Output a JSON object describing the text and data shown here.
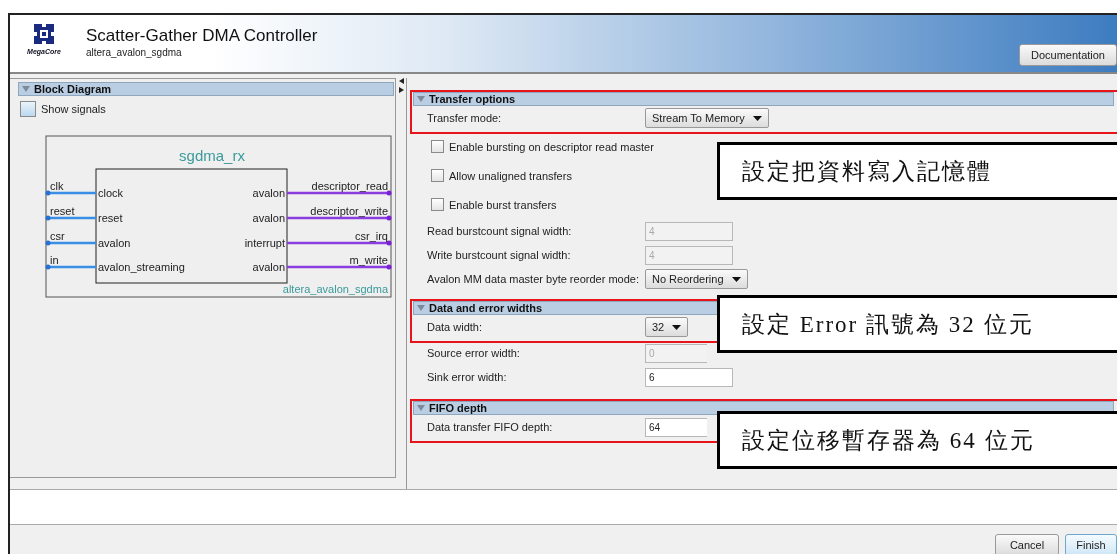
{
  "header": {
    "title": "Scatter-Gather DMA Controller",
    "subtitle": "altera_avalon_sgdma",
    "logo_text": "MegaCore",
    "documentation_button": "Documentation"
  },
  "block_diagram": {
    "title": "Block Diagram",
    "expanded": true,
    "show_signals": {
      "label": "Show signals",
      "checked": false
    },
    "component": {
      "instance": "sgdma_rx",
      "type": "altera_avalon_sgdma",
      "inputs": [
        {
          "signal": "clk",
          "port": "clock"
        },
        {
          "signal": "reset",
          "port": "reset"
        },
        {
          "signal": "csr",
          "port": "avalon"
        },
        {
          "signal": "in",
          "port": "avalon_streaming"
        }
      ],
      "outputs": [
        {
          "signal": "descriptor_read",
          "port": "avalon"
        },
        {
          "signal": "descriptor_write",
          "port": "avalon"
        },
        {
          "signal": "csr_irq",
          "port": "interrupt"
        },
        {
          "signal": "m_write",
          "port": "avalon"
        }
      ]
    }
  },
  "sections": [
    {
      "title": "Transfer options",
      "expanded": true,
      "highlighted": true,
      "callout": "設定把資料寫入記憶體",
      "rows": [
        {
          "kind": "dropdown",
          "label": "Transfer mode:",
          "value": "Stream To Memory"
        },
        {
          "kind": "checkbox",
          "label": "Enable bursting on descriptor read master",
          "checked": false
        },
        {
          "kind": "checkbox",
          "label": "Allow unaligned transfers",
          "checked": false
        },
        {
          "kind": "checkbox",
          "label": "Enable burst transfers",
          "checked": false
        },
        {
          "kind": "field",
          "label": "Read burstcount signal width:",
          "value": "4",
          "disabled": true
        },
        {
          "kind": "field",
          "label": "Write burstcount signal width:",
          "value": "4",
          "disabled": true
        },
        {
          "kind": "dropdown",
          "label": "Avalon MM data master byte reorder mode:",
          "value": "No Reordering"
        }
      ]
    },
    {
      "title": "Data and error widths",
      "expanded": true,
      "highlighted": true,
      "callout": "設定 Error 訊號為 32 位元",
      "rows": [
        {
          "kind": "dropdown",
          "label": "Data width:",
          "value": "32"
        },
        {
          "kind": "field",
          "label": "Source error width:",
          "value": "0",
          "disabled": true
        },
        {
          "kind": "field",
          "label": "Sink error width:",
          "value": "6",
          "disabled": false
        }
      ]
    },
    {
      "title": "FIFO depth",
      "expanded": true,
      "highlighted": true,
      "callout": "設定位移暫存器為 64 位元",
      "rows": [
        {
          "kind": "field",
          "label": "Data transfer FIFO depth:",
          "value": "64",
          "disabled": false
        }
      ]
    }
  ],
  "buttons": [
    {
      "label": "Cancel",
      "kind": "normal"
    },
    {
      "label": "Finish",
      "kind": "default"
    }
  ]
}
